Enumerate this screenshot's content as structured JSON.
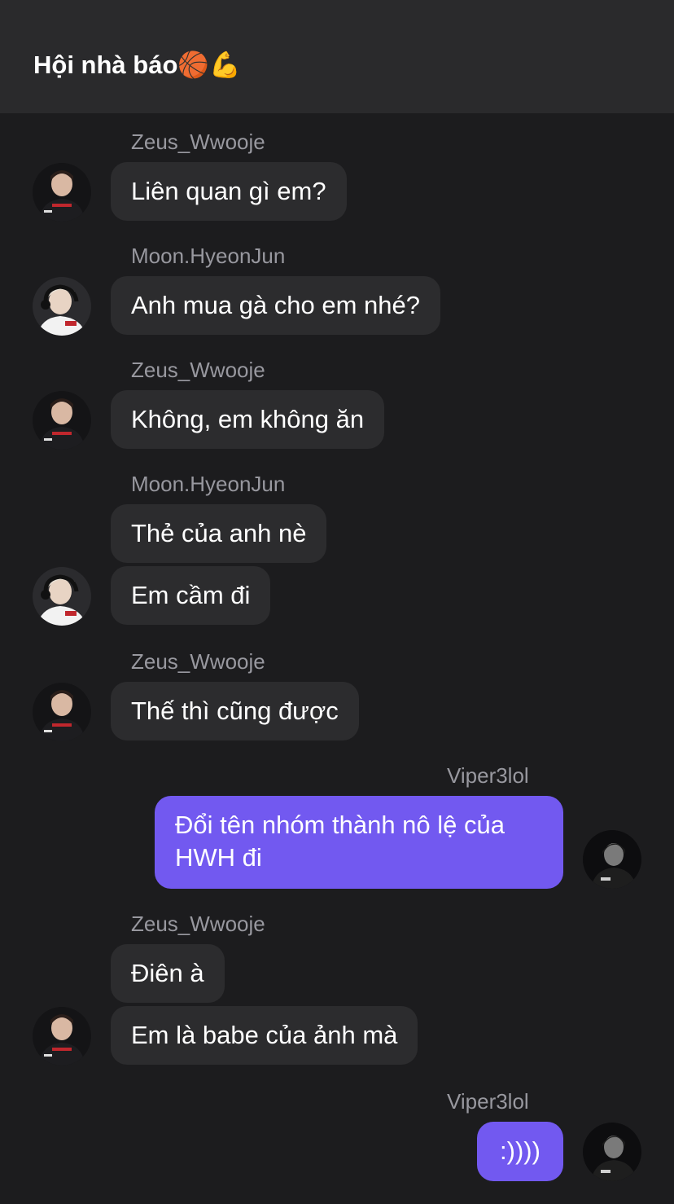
{
  "header": {
    "title": "Hội nhà báo🏀💪"
  },
  "messages": [
    {
      "sender": "Zeus_Wwooje",
      "text": "Liên quan gì em?"
    },
    {
      "sender": "Moon.HyeonJun",
      "text": "Anh mua gà cho em nhé?"
    },
    {
      "sender": "Zeus_Wwooje",
      "text": "Không, em không ăn"
    },
    {
      "sender": "Moon.HyeonJun",
      "text": "Thẻ của anh nè"
    },
    {
      "text": "Em cầm đi"
    },
    {
      "sender": "Zeus_Wwooje",
      "text": "Thế thì cũng được"
    },
    {
      "sender": "Viper3lol",
      "text": "Đổi tên nhóm thành nô lệ của HWH đi"
    },
    {
      "sender": "Zeus_Wwooje",
      "text": "Điên à"
    },
    {
      "text": "Em là babe của ảnh mà"
    },
    {
      "sender": "Viper3lol",
      "text": ":))))"
    }
  ],
  "colors": {
    "background": "#1c1c1e",
    "header": "#2a2a2c",
    "incoming_bubble": "#2c2c2e",
    "outgoing_bubble": "#7259f0",
    "sender_name": "#98989f"
  }
}
